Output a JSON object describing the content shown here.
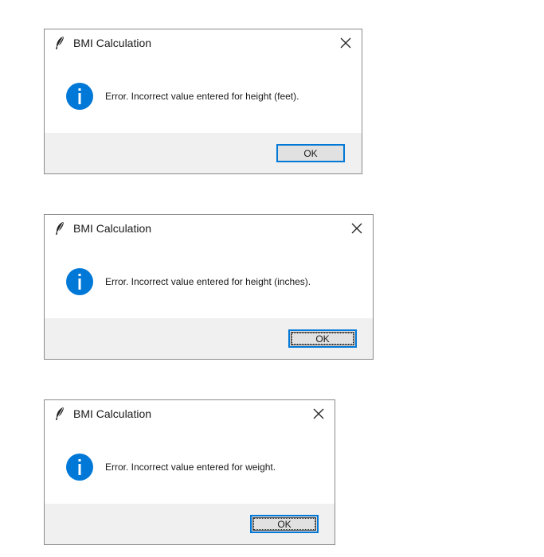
{
  "dialogs": [
    {
      "title": "BMI Calculation",
      "message": "Error. Incorrect value entered for height (feet).",
      "ok_label": "OK",
      "icon": "info-icon",
      "close_icon": "close-icon",
      "app_icon": "feather-icon"
    },
    {
      "title": "BMI Calculation",
      "message": "Error. Incorrect value entered for height (inches).",
      "ok_label": "OK",
      "icon": "info-icon",
      "close_icon": "close-icon",
      "app_icon": "feather-icon"
    },
    {
      "title": "BMI Calculation",
      "message": "Error. Incorrect value entered for weight.",
      "ok_label": "OK",
      "icon": "info-icon",
      "close_icon": "close-icon",
      "app_icon": "feather-icon"
    }
  ],
  "colors": {
    "info_blue": "#0078d7",
    "footer_gray": "#f0f0f0",
    "button_gray": "#e1e1e1"
  }
}
